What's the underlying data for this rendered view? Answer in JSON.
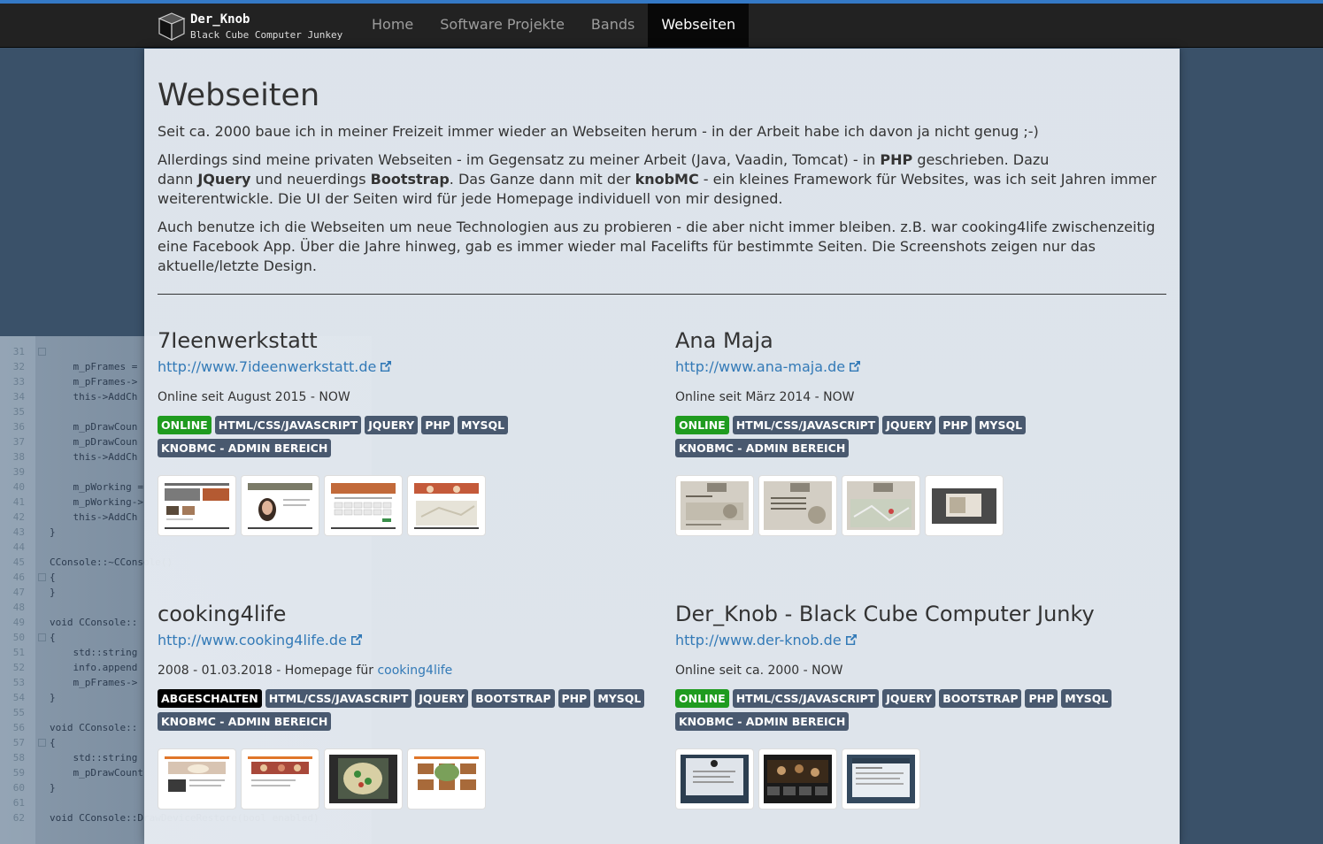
{
  "nav": {
    "brand_title": "Der_Knob",
    "brand_subtitle": "Black Cube Computer Junkey",
    "items": [
      {
        "label": "Home",
        "active": false
      },
      {
        "label": "Software Projekte",
        "active": false
      },
      {
        "label": "Bands",
        "active": false
      },
      {
        "label": "Webseiten",
        "active": true
      }
    ]
  },
  "page": {
    "title": "Webseiten",
    "intro1": "Seit ca. 2000 baue ich in meiner Freizeit immer wieder an Webseiten herum - in der Arbeit habe ich davon ja nicht genug ;-)",
    "intro2_a": "Allerdings sind meine privaten Webseiten - im Gegensatz zu meiner Arbeit (Java, Vaadin, Tomcat) - in ",
    "intro2_php": "PHP",
    "intro2_b": " geschrieben. Dazu",
    "intro2_c": "dann ",
    "intro2_jquery": "JQuery",
    "intro2_d": " und neuerdings ",
    "intro2_bootstrap": "Bootstrap",
    "intro2_e": ". Das Ganze dann mit der ",
    "intro2_knobmc": "knobMC",
    "intro2_f": " - ein kleines Framework für Websites, was ich seit Jahren immer",
    "intro2_g": "weiterentwickle. Die UI der Seiten wird für jede Homepage individuell von mir designed.",
    "intro3_a": "Auch benutze ich die Webseiten um neue Technologien aus zu probieren - die aber nicht immer bleiben. z.B. war cooking4life zwischenzeitig",
    "intro3_b": "eine Facebook App. Über die Jahre hinweg, gab es immer wieder mal Facelifts für bestimmte Seiten. Die Screenshots zeigen nur das",
    "intro3_c": "aktuelle/letzte Design."
  },
  "projects": [
    {
      "title": "7Ieenwerkstatt",
      "url": "http://www.7ideenwerkstatt.de",
      "desc": "Online seit August 2015 - NOW",
      "labels_row1": [
        "ONLINE",
        "HTML/CSS/JAVASCRIPT",
        "JQUERY",
        "PHP",
        "MYSQL"
      ],
      "labels_row2": [
        "KNOBMC - ADMIN BEREICH"
      ]
    },
    {
      "title": "Ana Maja",
      "url": "http://www.ana-maja.de",
      "desc": "Online seit März 2014 - NOW",
      "labels_row1": [
        "ONLINE",
        "HTML/CSS/JAVASCRIPT",
        "JQUERY",
        "PHP",
        "MYSQL"
      ],
      "labels_row2": [
        "KNOBMC - ADMIN BEREICH"
      ]
    },
    {
      "title": "cooking4life",
      "url": "http://www.cooking4life.de",
      "desc": "2008 - 01.03.2018 - Homepage für ",
      "desc_link": "cooking4life",
      "labels_row1": [
        "ABGESCHALTEN",
        "HTML/CSS/JAVASCRIPT",
        "JQUERY",
        "BOOTSTRAP",
        "PHP",
        "MYSQL"
      ],
      "labels_row2": [
        "KNOBMC - ADMIN BEREICH"
      ]
    },
    {
      "title": "Der_Knob - Black Cube Computer Junky",
      "url": "http://www.der-knob.de",
      "desc": "Online seit ca. 2000 - NOW",
      "labels_row1": [
        "ONLINE",
        "HTML/CSS/JAVASCRIPT",
        "JQUERY",
        "BOOTSTRAP",
        "PHP",
        "MYSQL"
      ],
      "labels_row2": [
        "KNOBMC - ADMIN BEREICH"
      ]
    }
  ],
  "colors": {
    "nav_bg": "#222222",
    "accent_stripe": "#3479c6",
    "link": "#337ab7",
    "label_default": "#49596f",
    "label_online": "#1f9b1f",
    "label_off": "#000000"
  }
}
